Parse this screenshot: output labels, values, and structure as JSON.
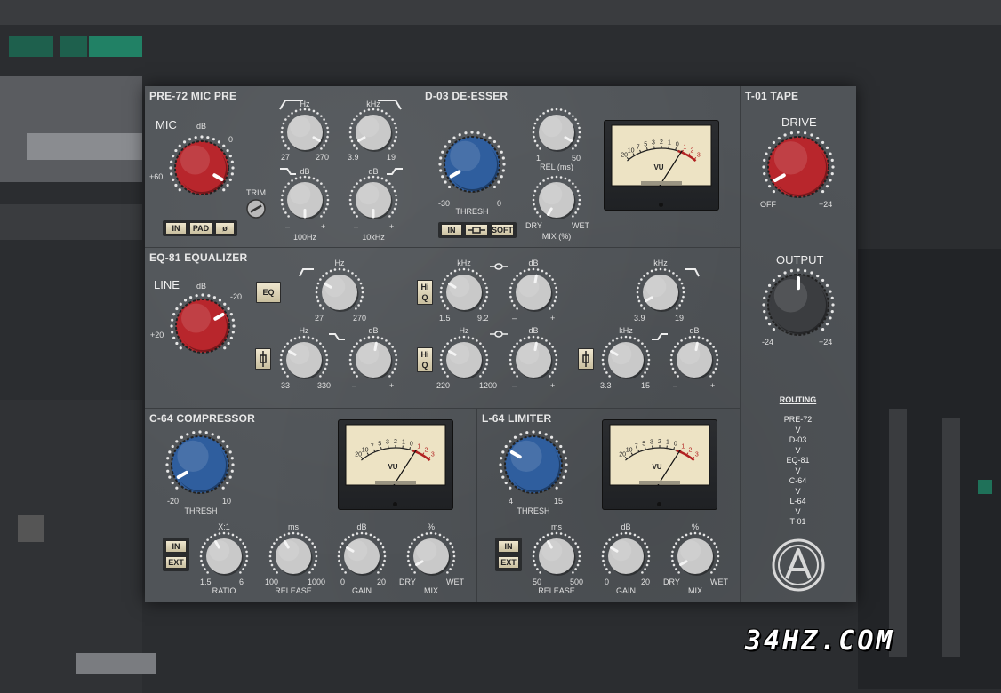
{
  "background": {
    "color": "#2b2d30",
    "accent": "#1ea57c"
  },
  "pre72": {
    "title": "PRE-72 MIC PRE",
    "mic_label": "MIC",
    "mic_db": "dB",
    "mic_min": "+60",
    "mic_max": "0",
    "hz_label": "Hz",
    "hz_min": "27",
    "hz_max": "270",
    "khz_label": "kHz",
    "khz_min": "3.9",
    "khz_max": "19",
    "trim_label": "TRIM",
    "db1_label": "dB",
    "db1_min": "–",
    "db1_freq": "100Hz",
    "db1_max": "+",
    "db2_label": "dB",
    "db2_min": "–",
    "db2_freq": "10kHz",
    "db2_max": "+",
    "in_btn": "IN",
    "pad_btn": "PAD",
    "phase_btn": "ø"
  },
  "d03": {
    "title": "D-03 DE-ESSER",
    "thresh_min": "-30",
    "thresh_max": "0",
    "thresh_label": "THRESH",
    "rel_min": "1",
    "rel_max": "50",
    "rel_label": "REL (ms)",
    "mix_min": "DRY",
    "mix_max": "WET",
    "mix_label": "MIX (%)",
    "in_btn": "IN",
    "soft_btn": "SOFT"
  },
  "t01": {
    "title": "T-01 TAPE",
    "drive_label": "DRIVE",
    "drive_min": "OFF",
    "drive_max": "+24",
    "output_label": "OUTPUT",
    "output_min": "-24",
    "output_max": "+24",
    "routing_title": "ROUTING",
    "routing": [
      "PRE-72",
      "V",
      "D-03",
      "V",
      "EQ-81",
      "V",
      "C-64",
      "V",
      "L-64",
      "V",
      "T-01"
    ]
  },
  "eq81": {
    "title": "EQ-81 EQUALIZER",
    "line_label": "LINE",
    "line_db": "dB",
    "line_min": "+20",
    "line_max": "-20",
    "eq_btn": "EQ",
    "k1_label": "Hz",
    "k1_min": "27",
    "k1_max": "270",
    "hiq1": "Hi Q",
    "k2_label": "kHz",
    "k2_min": "1.5",
    "k2_max": "9.2",
    "k3_label": "dB",
    "k3_min": "–",
    "k3_max": "+",
    "k4_label": "kHz",
    "k4_min": "3.9",
    "k4_max": "19",
    "k5_label": "Hz",
    "k5_min": "33",
    "k5_max": "330",
    "k6_label": "dB",
    "k6_min": "–",
    "k6_max": "+",
    "hiq2": "Hi Q",
    "k7_label": "Hz",
    "k7_min": "220",
    "k7_max": "1200",
    "k8_label": "dB",
    "k8_min": "–",
    "k8_max": "+",
    "k9_label": "kHz",
    "k9_min": "3.3",
    "k9_max": "15",
    "k10_label": "dB",
    "k10_min": "–",
    "k10_max": "+"
  },
  "c64": {
    "title": "C-64 COMPRESSOR",
    "thresh_min": "-20",
    "thresh_max": "10",
    "thresh_label": "THRESH",
    "in_btn": "IN",
    "ext_btn": "EXT",
    "ratio_unit": "X:1",
    "ratio_min": "1.5",
    "ratio_max": "6",
    "ratio_label": "RATIO",
    "release_unit": "ms",
    "release_min": "100",
    "release_max": "1000",
    "release_label": "RELEASE",
    "gain_unit": "dB",
    "gain_min": "0",
    "gain_max": "20",
    "gain_label": "GAIN",
    "mix_unit": "%",
    "mix_min": "DRY",
    "mix_max": "WET",
    "mix_label": "MIX"
  },
  "l64": {
    "title": "L-64 LIMITER",
    "thresh_min": "4",
    "thresh_max": "15",
    "thresh_label": "THRESH",
    "in_btn": "IN",
    "ext_btn": "EXT",
    "release_unit": "ms",
    "release_min": "50",
    "release_max": "500",
    "release_label": "RELEASE",
    "gain_unit": "dB",
    "gain_min": "0",
    "gain_max": "20",
    "gain_label": "GAIN",
    "mix_unit": "%",
    "mix_min": "DRY",
    "mix_max": "WET",
    "mix_label": "MIX"
  },
  "vu_scale": [
    "20",
    "10",
    "7",
    "5",
    "3",
    "2",
    "1",
    "0",
    "1",
    "2",
    "3"
  ],
  "vu_label": "VU",
  "colors": {
    "red": "#b8262c",
    "blue": "#2f5e9e",
    "grey": "#c9c9c9",
    "dark": "#3b3d40",
    "panel": "#505458",
    "cream": "#ede3c4"
  },
  "watermark": "34HZ.COM"
}
